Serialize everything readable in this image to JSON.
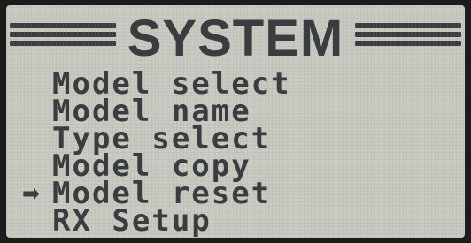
{
  "screen": {
    "title": "SYSTEM",
    "cursor_glyph": "➡",
    "menu": [
      {
        "label": "Model select",
        "selected": false
      },
      {
        "label": "Model name",
        "selected": false
      },
      {
        "label": "Type select",
        "selected": false
      },
      {
        "label": "Model copy",
        "selected": false
      },
      {
        "label": "Model reset",
        "selected": true
      },
      {
        "label": "RX Setup",
        "selected": false
      }
    ]
  },
  "colors": {
    "lcd_background": "#c9cbc2",
    "lcd_text": "#3a3d3f",
    "bezel": "#1c1c1c"
  }
}
